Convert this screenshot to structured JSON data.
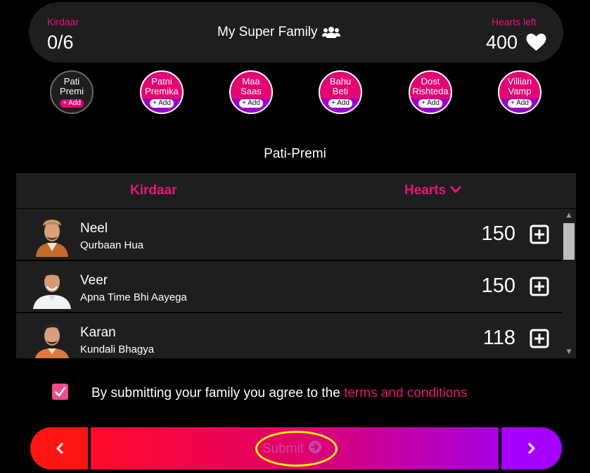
{
  "header": {
    "kirdaar_label": "Kirdaar",
    "kirdaar_value": "0/6",
    "title": "My Super Family",
    "title_icon": "users-icon",
    "hearts_label": "Hearts left",
    "hearts_value": "400",
    "hearts_icon": "heart-icon"
  },
  "slots": [
    {
      "line1": "Pati",
      "line2": "Premi",
      "add": "+ Add",
      "active": true
    },
    {
      "line1": "Patni",
      "line2": "Premika",
      "add": "+ Add",
      "active": false
    },
    {
      "line1": "Maa",
      "line2": "Saas",
      "add": "+ Add",
      "active": false
    },
    {
      "line1": "Bahu",
      "line2": "Beti",
      "add": "+ Add",
      "active": false
    },
    {
      "line1": "Dost",
      "line2": "Rishteda",
      "add": "+ Add",
      "active": false
    },
    {
      "line1": "Villian",
      "line2": "Vamp",
      "add": "+ Add",
      "active": false
    }
  ],
  "section_title": "Pati-Premi",
  "table": {
    "col_kirdaar": "Kirdaar",
    "col_hearts": "Hearts",
    "rows": [
      {
        "name": "Neel",
        "show": "Qurbaan Hua",
        "hearts": "150"
      },
      {
        "name": "Veer",
        "show": "Apna Time Bhi Aayega",
        "hearts": "150"
      },
      {
        "name": "Karan",
        "show": "Kundali Bhagya",
        "hearts": "118"
      }
    ]
  },
  "agreement": {
    "checked": true,
    "text": "By submitting your family you agree to the ",
    "link": "terms and conditions"
  },
  "nav": {
    "submit_label": "Submit"
  },
  "colors": {
    "accent": "#e8157a",
    "panel": "#1e1e1e",
    "highlight": "#f4ee16"
  }
}
